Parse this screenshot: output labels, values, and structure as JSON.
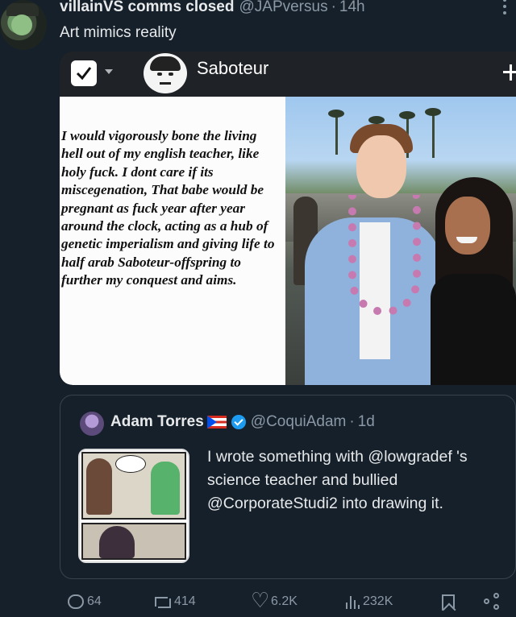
{
  "tweet": {
    "author_name": "villainVS comms closed",
    "author_handle": "@JAPversus",
    "separator": "·",
    "time": "14h",
    "text": "Art mimics reality"
  },
  "media": {
    "account_name": "Saboteur",
    "quote_text": "I would vigorously bone the living hell out of my english teacher, like holy fuck. I dont care if its miscegenation, That babe would be pregnant as fuck year after year around the clock, acting as a hub of genetic imperialism and giving life to half arab Saboteur-offspring to further my conquest and aims."
  },
  "quoted_tweet": {
    "author_name": "Adam Torres",
    "author_handle": "@CoquiAdam",
    "separator": "·",
    "time": "1d",
    "text": "I wrote something with @lowgradef 's science teacher  and bullied @CorporateStudi2 into drawing it."
  },
  "actions": {
    "replies": "64",
    "retweets": "414",
    "likes": "6.2K",
    "views": "232K"
  },
  "colors": {
    "background": "#15202b",
    "secondary_text": "#8b98a5",
    "verified": "#1d9bf0"
  },
  "icons": [
    "more-icon",
    "checkbox-icon",
    "plus-icon",
    "flag-pr-icon",
    "verified-icon",
    "reply-icon",
    "retweet-icon",
    "heart-icon",
    "views-icon",
    "bookmark-icon",
    "share-icon"
  ]
}
